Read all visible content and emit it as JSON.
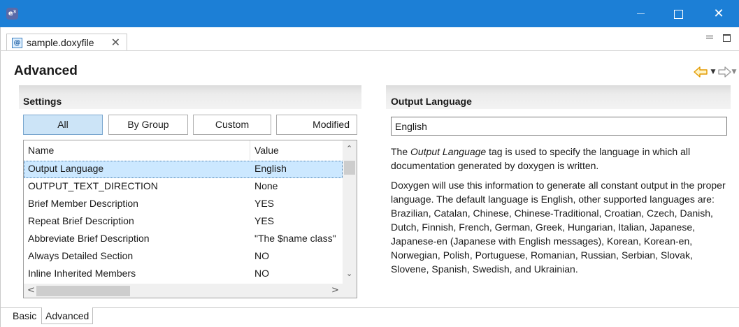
{
  "window": {
    "app_icon_glyph": "e³",
    "close_glyph": "✕"
  },
  "editor": {
    "tab_label": "sample.doxyfile",
    "tab_icon": "doxyfile-icon",
    "tab_close_glyph": "✕"
  },
  "form": {
    "title": "Advanced",
    "nav_dropdown_glyph": "▼"
  },
  "settings": {
    "section_title": "Settings",
    "filters": [
      "All",
      "By Group",
      "Custom",
      "Modified"
    ],
    "active_filter": "All",
    "columns": [
      "Name",
      "Value"
    ],
    "rows": [
      {
        "name": "Output Language",
        "value": "English",
        "selected": true
      },
      {
        "name": "OUTPUT_TEXT_DIRECTION",
        "value": "None"
      },
      {
        "name": "Brief Member Description",
        "value": "YES"
      },
      {
        "name": "Repeat Brief Description",
        "value": "YES"
      },
      {
        "name": "Abbreviate Brief Description",
        "value": "\"The $name class\""
      },
      {
        "name": "Always Detailed Section",
        "value": "NO"
      },
      {
        "name": "Inline Inherited Members",
        "value": "NO"
      }
    ],
    "scroll_up_glyph": "⌃",
    "scroll_down_glyph": "⌄",
    "scroll_left_glyph": "<",
    "scroll_right_glyph": ">"
  },
  "detail": {
    "section_title": "Output Language",
    "value": "English",
    "desc1_prefix": "The ",
    "desc1_em": "Output Language",
    "desc1_suffix": " tag is used to specify the language in which all documentation generated by doxygen is written.",
    "desc2": "Doxygen will use this information to generate all constant output in the proper language. The default language is English, other supported languages are: Brazilian, Catalan, Chinese, Chinese-Traditional, Croatian, Czech, Danish, Dutch, Finnish, French, German, Greek, Hungarian, Italian, Japanese, Japanese-en (Japanese with English messages), Korean, Korean-en, Norwegian, Polish, Portuguese, Romanian, Russian, Serbian, Slovak, Slovene, Spanish, Swedish, and Ukrainian."
  },
  "bottom_tabs": [
    "Basic",
    "Advanced"
  ],
  "active_bottom_tab": "Advanced",
  "colors": {
    "titlebar": "#1c7fd6",
    "selection": "#cce8ff",
    "active_filter": "#cce4f7",
    "nav_back_arrow": "#f0a400"
  }
}
